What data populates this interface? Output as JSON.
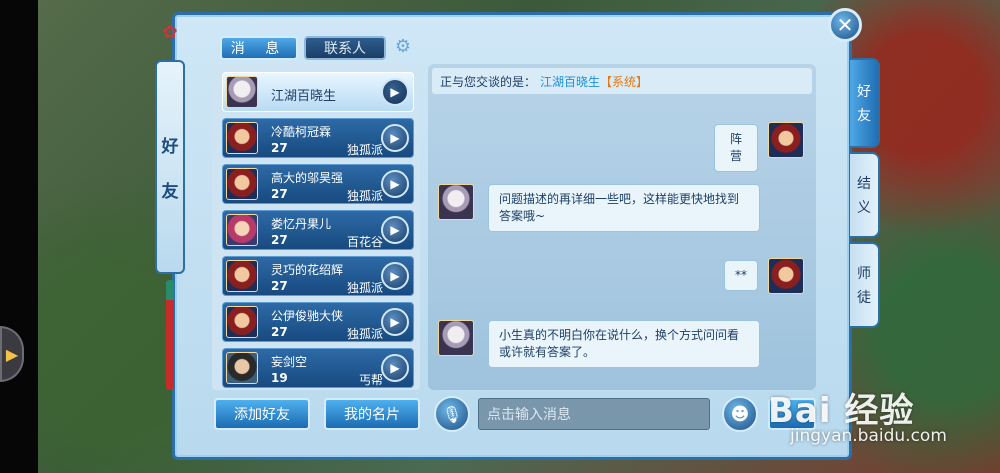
{
  "tabs": {
    "messages": "消 息",
    "contacts": "联系人"
  },
  "left_tab": [
    "好",
    "友"
  ],
  "right_tabs": [
    {
      "label": [
        "好",
        "友"
      ],
      "active": true
    },
    {
      "label": [
        "结",
        "义"
      ],
      "active": false
    },
    {
      "label": [
        "师",
        "徒"
      ],
      "active": false
    }
  ],
  "contacts": [
    {
      "name": "江湖百晓生",
      "level": "",
      "sect": "",
      "avatar": "hooded",
      "selected": true
    },
    {
      "name": "冷酷柯冠霖",
      "level": "27",
      "sect": "独孤派",
      "avatar": "red",
      "selected": false
    },
    {
      "name": "高大的邬昊强",
      "level": "27",
      "sect": "独孤派",
      "avatar": "red",
      "selected": false
    },
    {
      "name": "娄忆丹果儿",
      "level": "27",
      "sect": "百花谷",
      "avatar": "pink",
      "selected": false
    },
    {
      "name": "灵巧的花绍辉",
      "level": "27",
      "sect": "独孤派",
      "avatar": "red",
      "selected": false
    },
    {
      "name": "公伊俊驰大侠",
      "level": "27",
      "sect": "独孤派",
      "avatar": "red",
      "selected": false
    },
    {
      "name": "妄剑空",
      "level": "19",
      "sect": "丐帮",
      "avatar": "dark",
      "selected": false
    }
  ],
  "chat": {
    "header_prefix": "正与您交谈的是：",
    "header_name": "江湖百晓生",
    "header_tag": "【系统】",
    "messages": [
      {
        "side": "right",
        "text": "阵营",
        "avatar": "red"
      },
      {
        "side": "left",
        "text": "问题描述的再详细一些吧，这样能更快地找到答案哦~",
        "avatar": "hooded"
      },
      {
        "side": "right",
        "text": "**",
        "avatar": "red"
      },
      {
        "side": "left",
        "text": "小生真的不明白你在说什么，换个方式问问看或许就有答案了。",
        "avatar": "hooded"
      }
    ]
  },
  "bottom": {
    "add_friend": "添加好友",
    "my_card": "我的名片",
    "input_placeholder": "点击输入消息"
  },
  "watermark": {
    "logo": "Bai 经验",
    "url": "jingyan.baidu.com"
  },
  "icons": {
    "close": "close-icon",
    "gear": "gear-icon",
    "play": "play-icon",
    "mic": "microphone-icon",
    "emoji": "emoji-icon",
    "left_arrow": "chevron-right-icon"
  },
  "colors": {
    "accent": "#1f6fb4",
    "system_tag": "#e07a18",
    "contact_name": "#1e8fd6"
  }
}
